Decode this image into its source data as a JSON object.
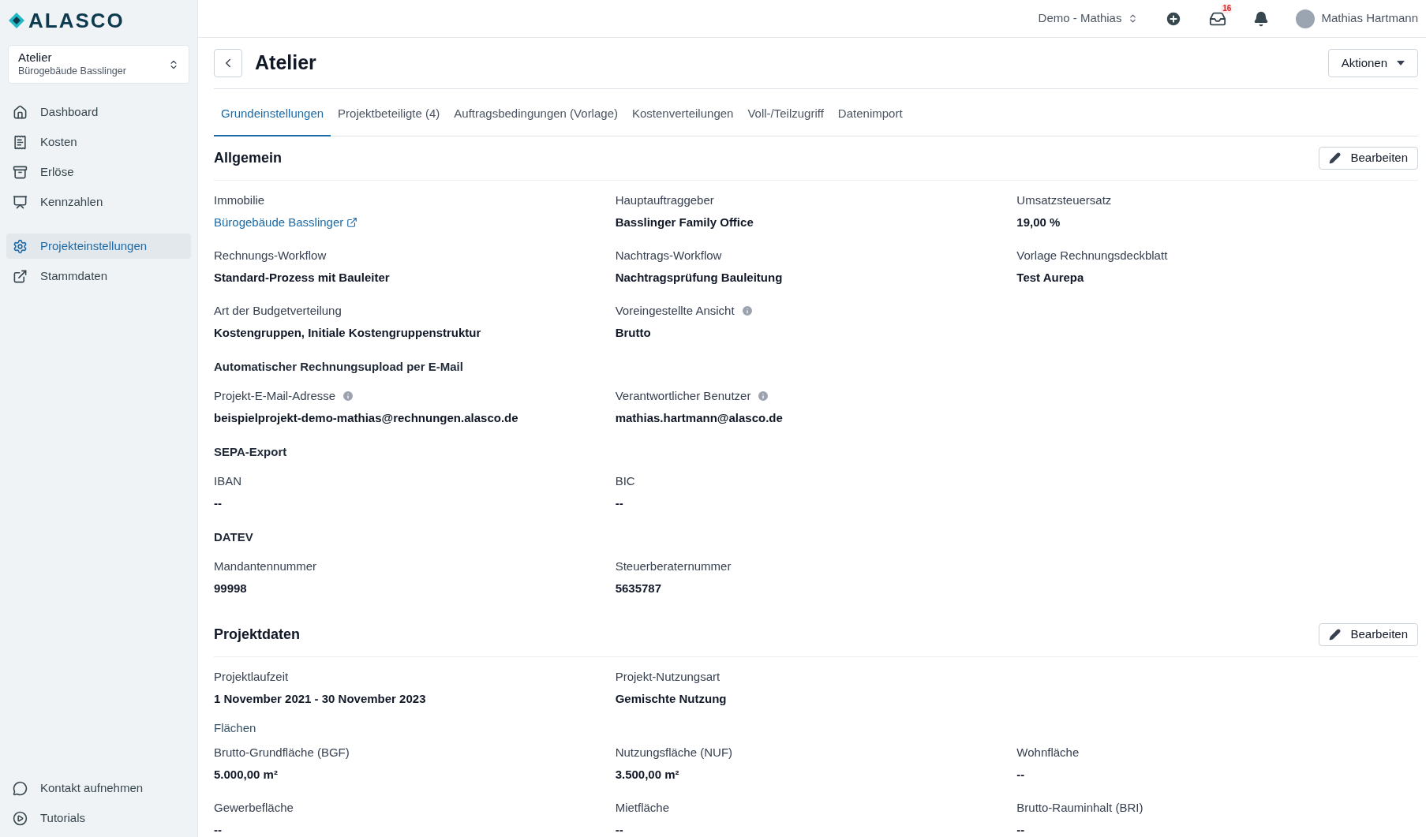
{
  "brand": "ALASCO",
  "project_picker": {
    "title": "Atelier",
    "subtitle": "Bürogebäude Basslinger"
  },
  "nav": [
    {
      "label": "Dashboard",
      "selected": false
    },
    {
      "label": "Kosten",
      "selected": false
    },
    {
      "label": "Erlöse",
      "selected": false
    },
    {
      "label": "Kennzahlen",
      "selected": false
    },
    {
      "label": "Projekteinstellungen",
      "selected": true
    },
    {
      "label": "Stammdaten",
      "selected": false
    }
  ],
  "nav_bottom": [
    {
      "label": "Kontakt aufnehmen"
    },
    {
      "label": "Tutorials"
    }
  ],
  "topbar": {
    "workspace": "Demo - Mathias",
    "inbox_badge": "16",
    "user": "Mathias Hartmann"
  },
  "page": {
    "title": "Atelier",
    "actions_button": "Aktionen"
  },
  "tabs": [
    {
      "label": "Grundeinstellungen",
      "selected": true
    },
    {
      "label": "Projektbeteiligte (4)",
      "selected": false
    },
    {
      "label": "Auftragsbedingungen (Vorlage)",
      "selected": false
    },
    {
      "label": "Kostenverteilungen",
      "selected": false
    },
    {
      "label": "Voll-/Teilzugriff",
      "selected": false
    },
    {
      "label": "Datenimport",
      "selected": false
    }
  ],
  "sections": [
    {
      "title": "Allgemein",
      "edit_button": "Bearbeiten",
      "items": [
        {
          "kind": "link",
          "label": "Immobilie",
          "value": "Bürogebäude Basslinger"
        },
        {
          "kind": "field",
          "label": "Hauptauftraggeber",
          "value": "Basslinger Family Office"
        },
        {
          "kind": "field",
          "label": "Umsatzsteuersatz",
          "value": "19,00 %"
        },
        {
          "kind": "field",
          "label": "Rechnungs-Workflow",
          "value": "Standard-Prozess mit Bauleiter"
        },
        {
          "kind": "field",
          "label": "Nachtrags-Workflow",
          "value": "Nachtragsprüfung Bauleitung"
        },
        {
          "kind": "field",
          "label": "Vorlage Rechnungsdeckblatt",
          "value": "Test Aurepa"
        },
        {
          "kind": "field",
          "label": "Art der Budgetverteilung",
          "value": "Kostengruppen, Initiale Kostengruppenstruktur"
        },
        {
          "kind": "field",
          "label": "Voreingestellte Ansicht",
          "value": "Brutto",
          "info": true
        },
        {
          "kind": "subheading",
          "label": "Automatischer Rechnungsupload per E-Mail"
        },
        {
          "kind": "field",
          "label": "Projekt-E-Mail-Adresse",
          "value": "beispielprojekt-demo-mathias@rechnungen.alasco.de",
          "info": true
        },
        {
          "kind": "field",
          "label": "Verantwortlicher Benutzer",
          "value": "mathias.hartmann@alasco.de",
          "info": true
        },
        {
          "kind": "subheading",
          "label": "SEPA-Export"
        },
        {
          "kind": "field",
          "label": "IBAN",
          "value": "--"
        },
        {
          "kind": "field",
          "label": "BIC",
          "value": "--"
        },
        {
          "kind": "subheading",
          "label": "DATEV"
        },
        {
          "kind": "field",
          "label": "Mandantennummer",
          "value": "99998"
        },
        {
          "kind": "field",
          "label": "Steuerberaternummer",
          "value": "5635787"
        }
      ]
    },
    {
      "title": "Projektdaten",
      "edit_button": "Bearbeiten",
      "items": [
        {
          "kind": "field",
          "label": "Projektlaufzeit",
          "value": "1 November 2021 - 30 November 2023"
        },
        {
          "kind": "field",
          "label": "Projekt-Nutzungsart",
          "value": "Gemischte Nutzung"
        },
        {
          "kind": "group",
          "label": "Flächen"
        },
        {
          "kind": "field",
          "label": "Brutto-Grundfläche (BGF)",
          "value": "5.000,00 m²"
        },
        {
          "kind": "field",
          "label": "Nutzungsfläche (NUF)",
          "value": "3.500,00 m²"
        },
        {
          "kind": "field",
          "label": "Wohnfläche",
          "value": "--"
        },
        {
          "kind": "field",
          "label": "Gewerbefläche",
          "value": "--"
        },
        {
          "kind": "field",
          "label": "Mietfläche",
          "value": "--"
        },
        {
          "kind": "field",
          "label": "Brutto-Rauminhalt (BRI)",
          "value": "--"
        }
      ]
    }
  ]
}
